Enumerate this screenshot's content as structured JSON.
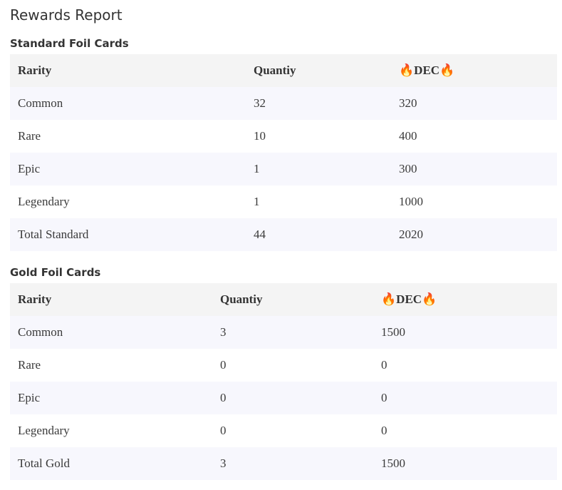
{
  "title": "Rewards Report",
  "standard": {
    "heading": "Standard Foil Cards",
    "columns": [
      "Rarity",
      "Quantiy",
      "🔥DEC🔥"
    ],
    "rows": [
      [
        "Common",
        "32",
        "320"
      ],
      [
        "Rare",
        "10",
        "400"
      ],
      [
        "Epic",
        "1",
        "300"
      ],
      [
        "Legendary",
        "1",
        "1000"
      ],
      [
        "Total Standard",
        "44",
        "2020"
      ]
    ]
  },
  "gold": {
    "heading": "Gold Foil Cards",
    "columns": [
      "Rarity",
      "Quantiy",
      "🔥DEC🔥"
    ],
    "rows": [
      [
        "Common",
        "3",
        "1500"
      ],
      [
        "Rare",
        "0",
        "0"
      ],
      [
        "Epic",
        "0",
        "0"
      ],
      [
        "Legendary",
        "0",
        "0"
      ],
      [
        "Total Gold",
        "3",
        "1500"
      ]
    ]
  }
}
